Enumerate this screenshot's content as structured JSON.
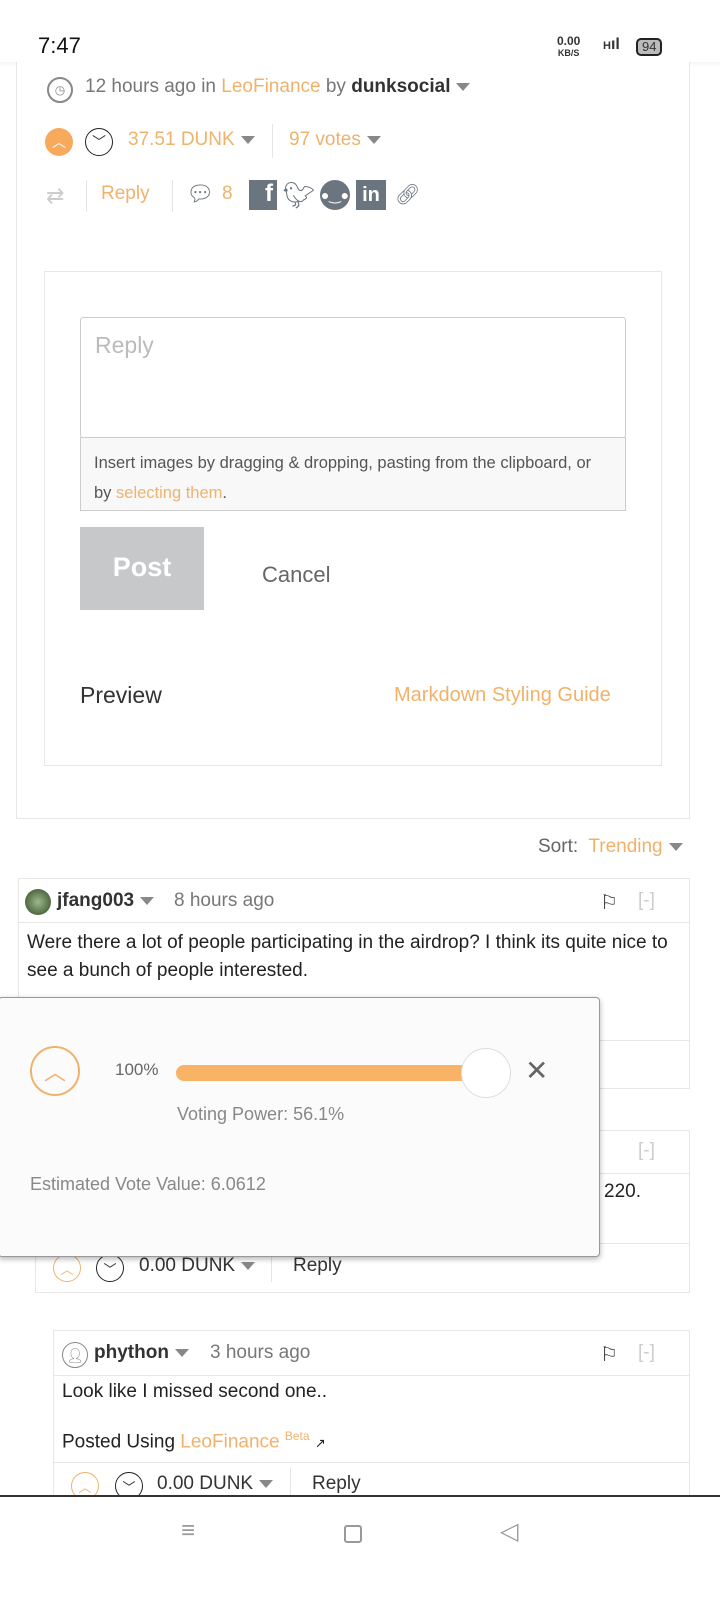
{
  "status_bar": {
    "time": "7:47",
    "net_speed": "0.00",
    "net_unit": "KB/S",
    "signal": "H",
    "battery": "94"
  },
  "post": {
    "time": "12 hours ago in",
    "community": "LeoFinance",
    "by": "by",
    "author": "dunksocial",
    "payout": "37.51 DUNK",
    "votes": "97 votes",
    "reply": "Reply",
    "comments_count": "8"
  },
  "reply_box": {
    "placeholder": "Reply",
    "hint_prefix": "Insert images by dragging & dropping, pasting from the clipboard, or by ",
    "hint_link": "selecting them",
    "hint_suffix": ".",
    "post": "Post",
    "cancel": "Cancel",
    "preview": "Preview",
    "markdown_guide": "Markdown Styling Guide"
  },
  "sort": {
    "label": "Sort:",
    "value": "Trending"
  },
  "comments": [
    {
      "author": "jfang003",
      "time": "8 hours ago",
      "collapse": "[-]",
      "text": "Were there a lot of people participating in the airdrop? I think its quite nice to see a bunch of people interested."
    },
    {
      "collapse": "[-]",
      "text_fragment": "220.",
      "payout": "0.00 DUNK",
      "reply": "Reply"
    },
    {
      "author": "phython",
      "time": "3 hours ago",
      "collapse": "[-]",
      "text": "Look like I missed second one..",
      "posted_using": "Posted Using",
      "app": "LeoFinance",
      "beta": "Beta",
      "payout": "0.00 DUNK",
      "reply": "Reply"
    }
  ],
  "vote_popup": {
    "percent": "100%",
    "slider_value": 100,
    "voting_power": "Voting Power: 56.1%",
    "estimated": "Estimated Vote Value: 6.0612"
  },
  "colors": {
    "accent": "#f0b26b",
    "slider": "#f9b367"
  }
}
